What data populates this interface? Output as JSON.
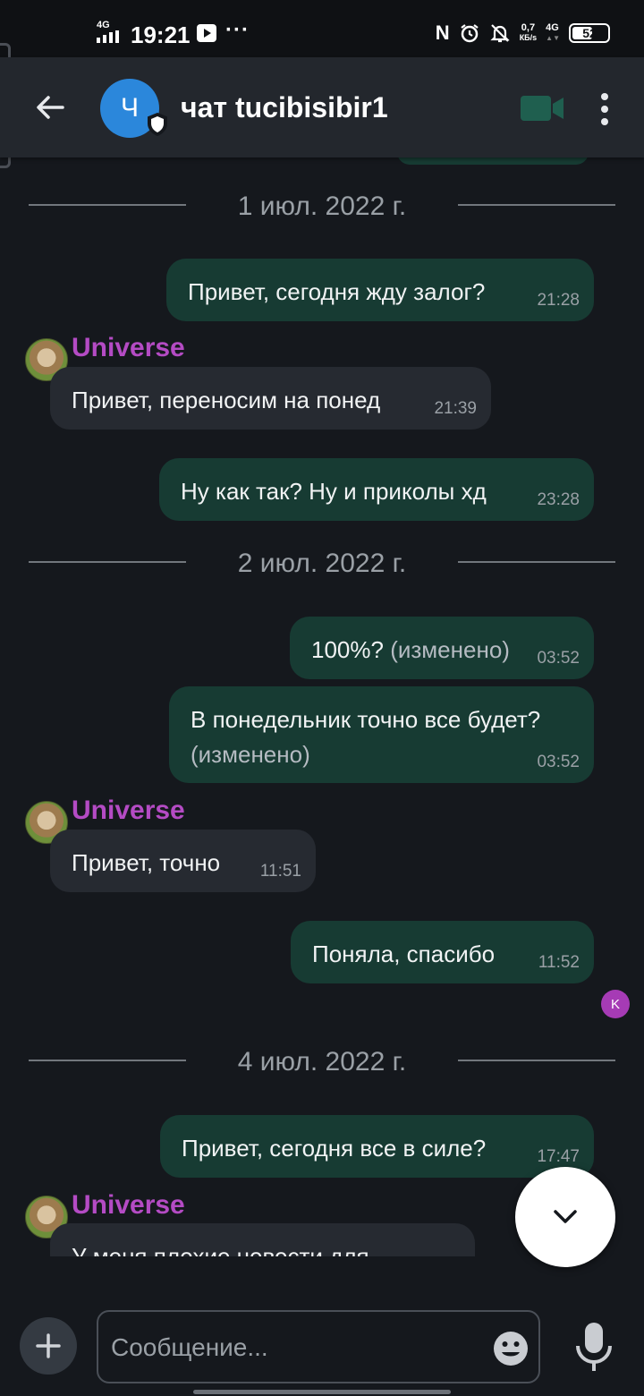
{
  "status_bar": {
    "network_left": "4G",
    "time": "19:21",
    "more": "···",
    "speed_value": "0,7",
    "speed_unit": "КБ/s",
    "network_right": "4G",
    "battery": "52"
  },
  "header": {
    "avatar_letter": "Ч",
    "title": "чат tucibisibir1"
  },
  "timeline": {
    "dates": [
      "1 июл. 2022 г.",
      "2 июл. 2022 г.",
      "4 июл. 2022 г."
    ],
    "sender": "Universe",
    "edited_label": "(изменено)",
    "messages": [
      {
        "text": "Привет, сегодня жду залог?",
        "time": "21:28"
      },
      {
        "text": "Привет, переносим на понед",
        "time": "21:39"
      },
      {
        "text": "Ну как так? Ну и приколы хд",
        "time": "23:28"
      },
      {
        "text": "100%?",
        "time": "03:52"
      },
      {
        "text": "В понедельник точно все будет?",
        "time": "03:52"
      },
      {
        "text": "Привет, точно",
        "time": "11:51"
      },
      {
        "text": "Поняла, спасибо",
        "time": "11:52"
      },
      {
        "text": "Привет, сегодня все в силе?",
        "time": "17:47"
      },
      {
        "text": "У меня плохие новости для",
        "time": ""
      }
    ],
    "read_receipt_letter": "K"
  },
  "composer": {
    "placeholder": "Сообщение..."
  },
  "colors": {
    "background": "#15181d",
    "header": "#23272d",
    "outgoing_bubble": "#173b33",
    "incoming_bubble": "#262a31",
    "sender_name": "#b44bc4",
    "avatar": "#2b87db",
    "video_icon": "#1f5f4f"
  },
  "icons": {
    "back": "arrow-left-icon",
    "shield": "shield-icon",
    "video": "video-camera-icon",
    "more": "more-vertical-icon",
    "scroll": "chevron-down-icon",
    "add": "plus-icon",
    "emoji": "emoji-icon",
    "mic": "microphone-icon"
  }
}
